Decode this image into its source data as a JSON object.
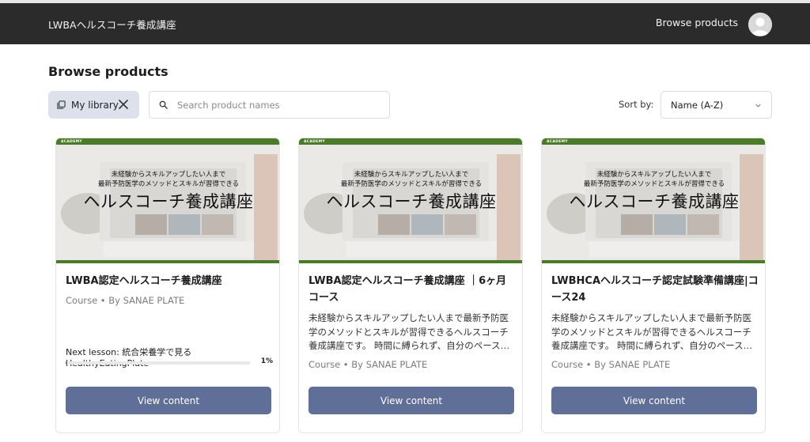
{
  "header": {
    "brand": "LWBAヘルスコーチ養成講座",
    "nav_link": "Browse products"
  },
  "page": {
    "title": "Browse products"
  },
  "filters": {
    "chip_label": "My library",
    "search_placeholder": "Search product names",
    "sort_label": "Sort by:",
    "sort_value": "Name (A-Z)"
  },
  "card_image": {
    "academy_text": "ACADEMY",
    "line1": "未経験からスキルアップしたい人まで",
    "line2": "最新予防医学のメソッドとスキルが習得できる",
    "headline": "ヘルスコーチ養成講座"
  },
  "products": [
    {
      "title": "LWBA認定ヘルスコーチ養成講座",
      "meta": "Course • By SANAE PLATE",
      "next_lesson": "Next lesson: 統合栄養学で見るHealthyEatingPlate",
      "progress_percent": 1,
      "progress_label": "1%",
      "button": "View content"
    },
    {
      "title": "LWBA認定ヘルスコーチ養成講座 ｜6ヶ月コース",
      "description": "未経験からスキルアップしたい人まで最新予防医学のメソッドとスキルが習得できるヘルスコーチ養成講座です。 時間に縛られず、自分のペース…",
      "meta": "Course • By SANAE PLATE",
      "button": "View content"
    },
    {
      "title": "LWBHCAヘルスコーチ認定試験準備講座|コース24",
      "description": "未経験からスキルアップしたい人まで最新予防医学のメソッドとスキルが習得できるヘルスコーチ養成講座です。 時間に縛られず、自分のペース…",
      "meta": "Course • By SANAE PLATE",
      "button": "View content"
    }
  ],
  "colors": {
    "header_bg": "#2b2b2b",
    "accent": "#5f6f98",
    "chip_bg": "#dce1ec",
    "image_green": "#4b7a2b"
  },
  "icons": [
    "library-icon",
    "close-icon",
    "search-icon",
    "chevron-down-icon",
    "avatar-icon"
  ]
}
